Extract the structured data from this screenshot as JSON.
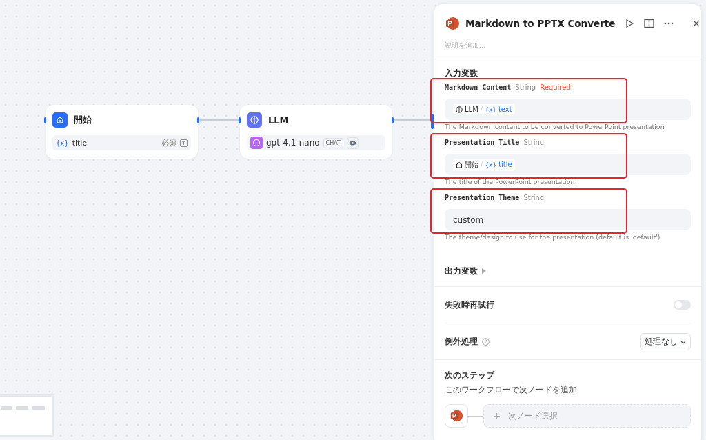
{
  "canvas": {
    "nodes": [
      {
        "kind": "start",
        "title": "開始",
        "row_icon": "{x}",
        "row_label": "title",
        "row_meta": "必須"
      },
      {
        "kind": "llm",
        "title": "LLM",
        "model": "gpt-4.1-nano",
        "badge": "CHAT"
      }
    ]
  },
  "panel": {
    "title": "Markdown to PPTX Converte",
    "description_placeholder": "説明を追加...",
    "input_heading": "入力変数",
    "inputs": [
      {
        "kind": "reference",
        "name": "Markdown Content",
        "type": "String",
        "required": "Required",
        "highlighted": true,
        "source": {
          "kind": "llm",
          "node": "LLM",
          "separator": "/",
          "variable_icon": "{x}",
          "variable": "text"
        },
        "help": "The Markdown content to be converted to PowerPoint presentation"
      },
      {
        "kind": "reference",
        "name": "Presentation Title",
        "type": "String",
        "highlighted": true,
        "source": {
          "kind": "start",
          "node": "開始",
          "separator": "/",
          "variable_icon": "{x}",
          "variable": "title"
        },
        "help": "The title of the PowerPoint presentation"
      },
      {
        "kind": "text",
        "name": "Presentation Theme",
        "type": "String",
        "highlighted": true,
        "value": "custom",
        "help": "The theme/design to use for the presentation (default is 'default')"
      }
    ],
    "output_heading": "出力変数",
    "output_expanded": false,
    "retry": {
      "label": "失敗時再試行",
      "on": false
    },
    "error_handling": {
      "label": "例外処理",
      "value": "処理なし"
    },
    "next_step": {
      "title": "次のステップ",
      "subtitle": "このワークフローで次ノードを追加",
      "placeholder": "次ノード選択"
    }
  }
}
